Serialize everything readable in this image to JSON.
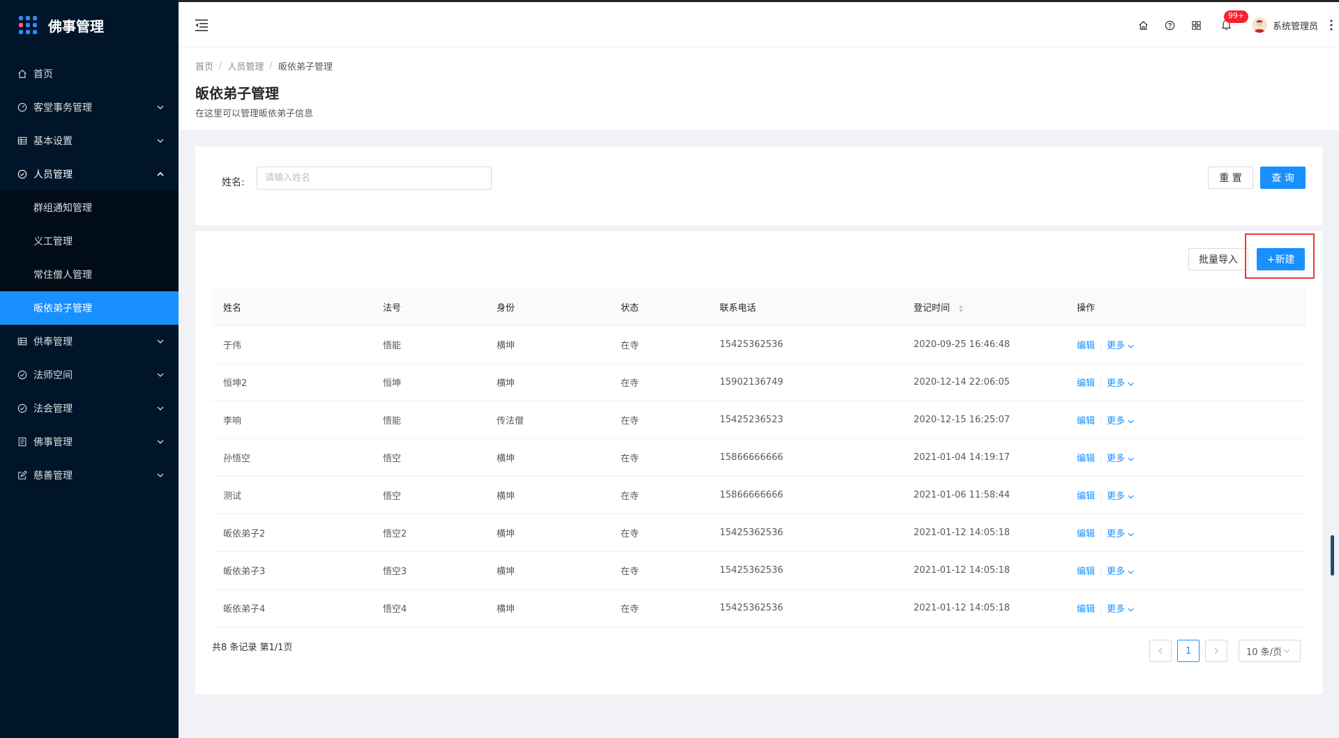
{
  "app": {
    "title": "佛事管理"
  },
  "colors": {
    "sidebar_bg": "#001529",
    "primary": "#1890ff",
    "badge": "#f5222d",
    "highlight": "#e53935"
  },
  "sidebar": {
    "items": [
      {
        "label": "首页",
        "icon": "home-icon",
        "has_arrow": false
      },
      {
        "label": "客堂事务管理",
        "icon": "dashboard-icon",
        "has_arrow": true
      },
      {
        "label": "基本设置",
        "icon": "table-icon",
        "has_arrow": true
      },
      {
        "label": "人员管理",
        "icon": "check-circle-icon",
        "has_arrow": true,
        "open": true,
        "children": [
          "群组通知管理",
          "义工管理",
          "常住僧人管理",
          "皈依弟子管理"
        ]
      },
      {
        "label": "供奉管理",
        "icon": "table-icon",
        "has_arrow": true
      },
      {
        "label": "法师空间",
        "icon": "check-circle-icon",
        "has_arrow": true
      },
      {
        "label": "法会管理",
        "icon": "check-circle-icon",
        "has_arrow": true
      },
      {
        "label": "佛事管理",
        "icon": "profile-icon",
        "has_arrow": true
      },
      {
        "label": "慈善管理",
        "icon": "edit-icon",
        "has_arrow": true
      }
    ],
    "active_child": "皈依弟子管理"
  },
  "header": {
    "badge": "99+",
    "user_name": "系统管理员"
  },
  "breadcrumb": [
    "首页",
    "人员管理",
    "皈依弟子管理"
  ],
  "page": {
    "title": "皈依弟子管理",
    "description": "在这里可以管理皈依弟子信息"
  },
  "search": {
    "label": "姓名:",
    "placeholder": "请输入姓名",
    "value": "",
    "reset_label": "重 置",
    "query_label": "查 询"
  },
  "toolbar": {
    "import_label": "批量导入",
    "new_label": "+新建"
  },
  "table": {
    "columns": [
      "姓名",
      "法号",
      "身份",
      "状态",
      "联系电话",
      "登记时间",
      "操作"
    ],
    "rows": [
      {
        "name": "于伟",
        "dharma": "悟能",
        "identity": "横坤",
        "status": "在寺",
        "phone": "15425362536",
        "time": "2020-09-25 16:46:48"
      },
      {
        "name": "恒坤2",
        "dharma": "恒坤",
        "identity": "横坤",
        "status": "在寺",
        "phone": "15902136749",
        "time": "2020-12-14 22:06:05"
      },
      {
        "name": "李响",
        "dharma": "悟能",
        "identity": "传法僧",
        "status": "在寺",
        "phone": "15425236523",
        "time": "2020-12-15 16:25:07"
      },
      {
        "name": "孙悟空",
        "dharma": "悟空",
        "identity": "横坤",
        "status": "在寺",
        "phone": "15866666666",
        "time": "2021-01-04 14:19:17"
      },
      {
        "name": "测试",
        "dharma": "悟空",
        "identity": "横坤",
        "status": "在寺",
        "phone": "15866666666",
        "time": "2021-01-06 11:58:44"
      },
      {
        "name": "皈依弟子2",
        "dharma": "悟空2",
        "identity": "横坤",
        "status": "在寺",
        "phone": "15425362536",
        "time": "2021-01-12 14:05:18"
      },
      {
        "name": "皈依弟子3",
        "dharma": "悟空3",
        "identity": "横坤",
        "status": "在寺",
        "phone": "15425362536",
        "time": "2021-01-12 14:05:18"
      },
      {
        "name": "皈依弟子4",
        "dharma": "悟空4",
        "identity": "横坤",
        "status": "在寺",
        "phone": "15425362536",
        "time": "2021-01-12 14:05:18"
      }
    ],
    "edit_label": "编辑",
    "more_label": "更多"
  },
  "pagination": {
    "summary": "共8 条记录 第1/1页",
    "current_page": "1",
    "page_size": "10 条/页"
  }
}
